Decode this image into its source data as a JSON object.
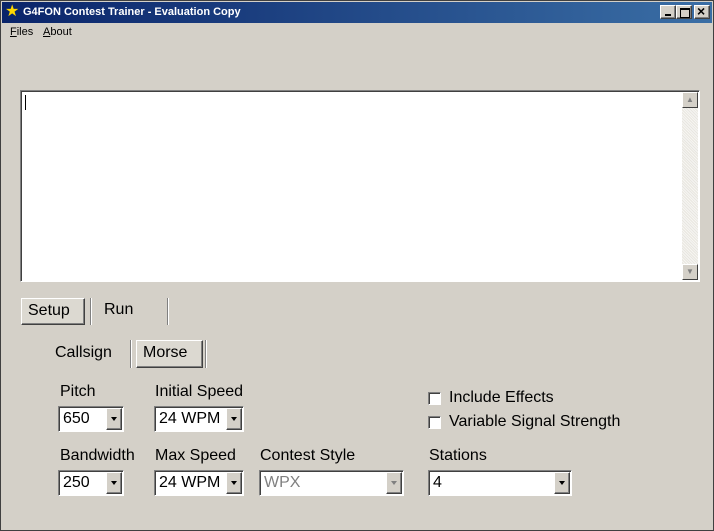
{
  "window": {
    "title": "G4FON Contest Trainer - Evaluation Copy",
    "app_icon": "star-icon"
  },
  "menu": {
    "files": "Files",
    "about": "About"
  },
  "memo": {
    "text": ""
  },
  "main_tabs": [
    {
      "label": "Setup",
      "selected": true
    },
    {
      "label": "Run",
      "selected": false
    }
  ],
  "sub_tabs": [
    {
      "label": "Callsign",
      "selected": false
    },
    {
      "label": "Morse",
      "selected": true
    }
  ],
  "fields": {
    "pitch": {
      "label": "Pitch",
      "value": "650"
    },
    "initial_speed": {
      "label": "Initial Speed",
      "value": "24 WPM"
    },
    "bandwidth": {
      "label": "Bandwidth",
      "value": "250"
    },
    "max_speed": {
      "label": "Max Speed",
      "value": "24 WPM"
    },
    "contest_style": {
      "label": "Contest Style",
      "value": "WPX",
      "disabled": true
    },
    "stations": {
      "label": "Stations",
      "value": "4"
    }
  },
  "checkboxes": {
    "include_effects": {
      "label": "Include Effects",
      "checked": false
    },
    "variable_signal": {
      "label": "Variable Signal Strength",
      "checked": false
    }
  }
}
